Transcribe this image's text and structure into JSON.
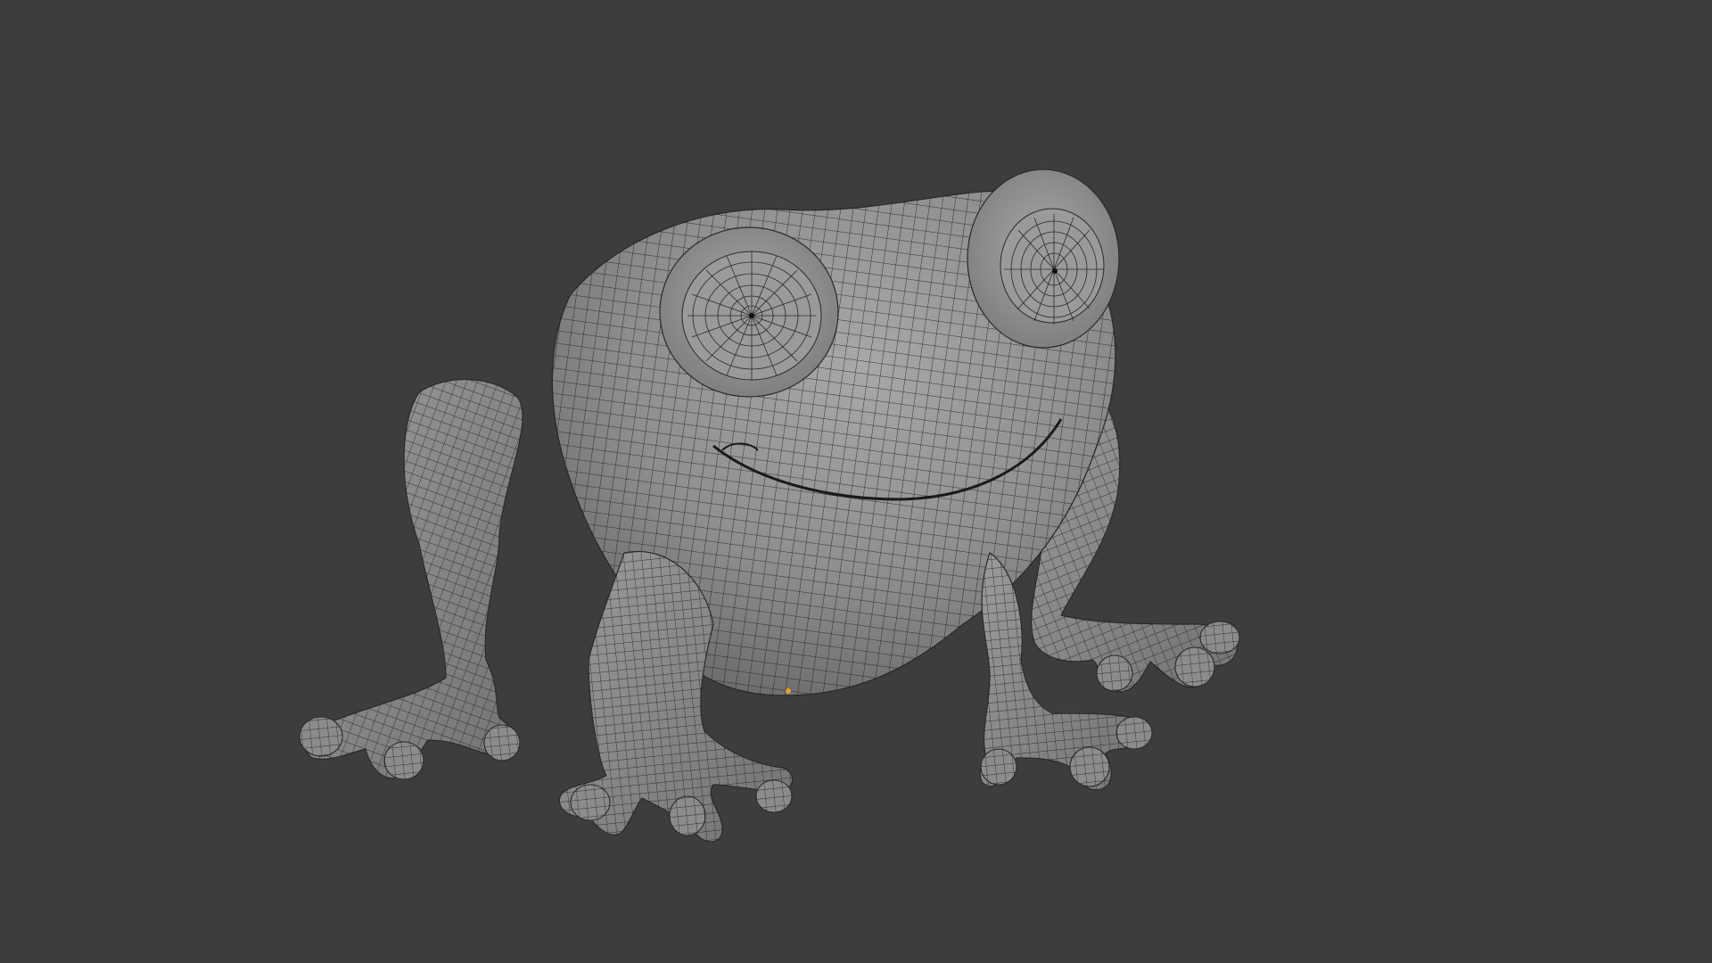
{
  "viewport": {
    "background_color": "#3d3d3d",
    "mesh_fill_color": "#8f8f8f",
    "mesh_shade_color": "#6c6c6c",
    "mesh_highlight_color": "#a6a6a6",
    "wire_color": "#1e1e1e",
    "origin_color": "#f0a020",
    "object_icon": "frog-icon"
  }
}
